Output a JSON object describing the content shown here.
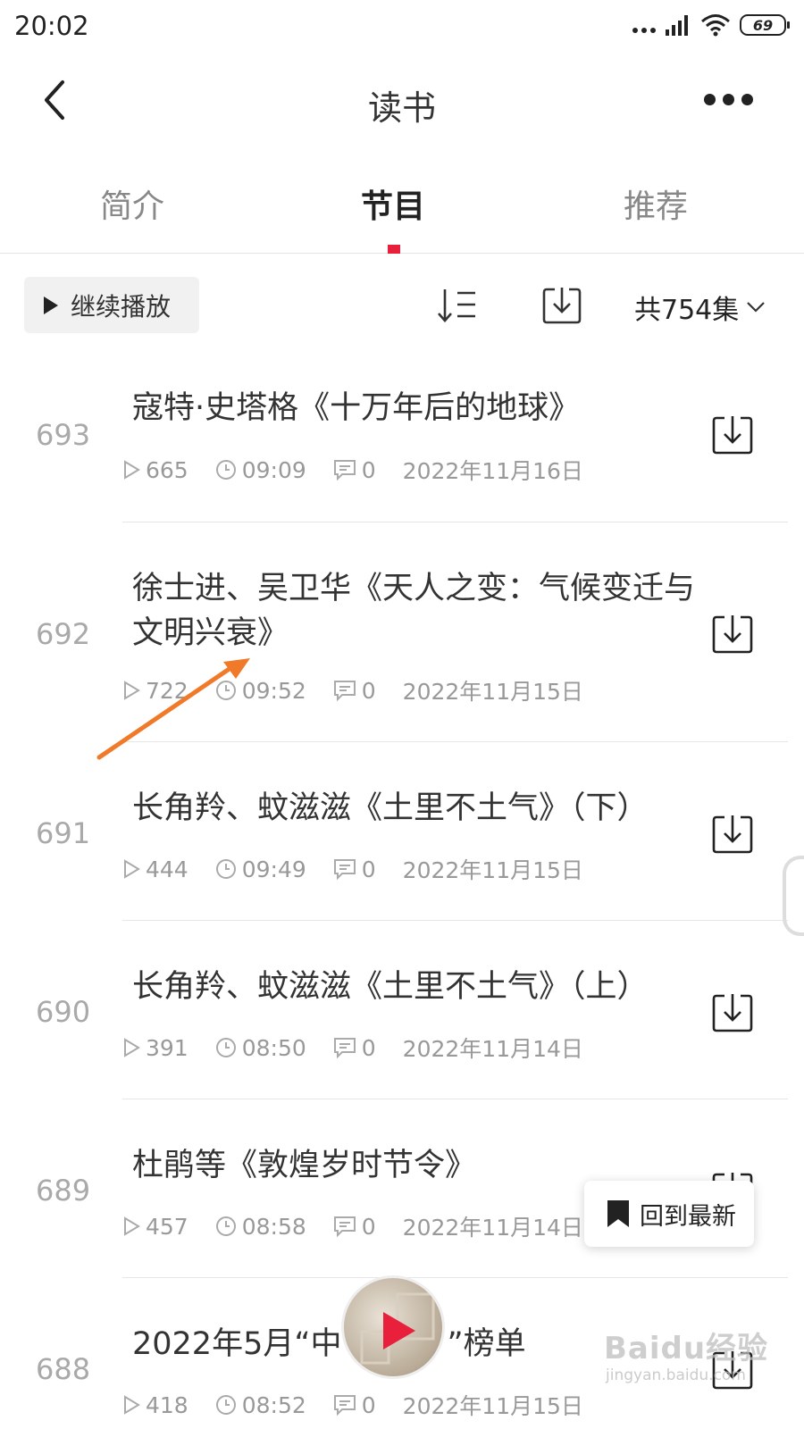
{
  "status_bar": {
    "time": "20:02",
    "battery": "69"
  },
  "header": {
    "title": "读书"
  },
  "tabs": [
    {
      "label": "简介"
    },
    {
      "label": "节目"
    },
    {
      "label": "推荐"
    }
  ],
  "active_tab": "节目",
  "toolbar": {
    "continue_label": "继续播放",
    "total": "共754集"
  },
  "episodes": [
    {
      "number": "693",
      "title": "寇特·史塔格《十万年后的地球》",
      "plays": "665",
      "duration": "09:09",
      "comments": "0",
      "date": "2022年11月16日"
    },
    {
      "number": "692",
      "title": "徐士进、吴卫华《天人之变：气候变迁与文明兴衰》",
      "plays": "722",
      "duration": "09:52",
      "comments": "0",
      "date": "2022年11月15日"
    },
    {
      "number": "691",
      "title": "长角羚、蚊滋滋《土里不土气》（下）",
      "plays": "444",
      "duration": "09:49",
      "comments": "0",
      "date": "2022年11月15日"
    },
    {
      "number": "690",
      "title": "长角羚、蚊滋滋《土里不土气》（上）",
      "plays": "391",
      "duration": "08:50",
      "comments": "0",
      "date": "2022年11月14日"
    },
    {
      "number": "689",
      "title": "杜鹃等《敦煌岁时节令》",
      "plays": "457",
      "duration": "08:58",
      "comments": "0",
      "date": "2022年11月14日"
    },
    {
      "number": "688",
      "title": "2022年5月“中",
      "title_end": "”榜单",
      "plays": "418",
      "duration": "08:52",
      "comments": "0",
      "date": "2022年11月15日"
    }
  ],
  "floating": {
    "back_to_latest": "回到最新"
  },
  "watermark": {
    "text": "Baidu经验",
    "sub": "jingyan.baidu.com"
  },
  "colors": {
    "accent": "#e8203c",
    "annotation_arrow": "#f07a2a"
  }
}
